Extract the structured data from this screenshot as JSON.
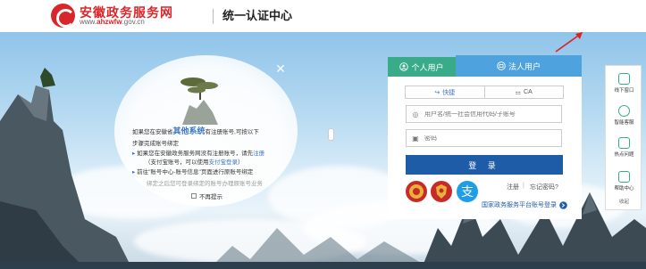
{
  "header": {
    "site_title": "安徽政务服务网",
    "site_url_prefix": "www.",
    "site_url_bold": "ahzwfw",
    "site_url_suffix": ".gov.cn",
    "subtitle": "统一认证中心"
  },
  "notice": {
    "line1_a": "如果您在安徽省",
    "line1_em": "其他系统",
    "line1_b": "有注册账号,可按以下",
    "line2": "步骤完成账号绑定",
    "line3_a": "如果您在安徽政务服务网没有注册账号，请先",
    "line3_link": "注册",
    "line4_a": "（支付宝账号，可以使用",
    "line4_link": "支付宝登录",
    "line4_b": "）",
    "line5": "前往\"账号中心-账号信息\"页面进行原账号绑定",
    "line6": "绑定之后您可登录绑定的账号办理原账号业务",
    "no_remind": "不再提示"
  },
  "login": {
    "tab_personal": "个人用户",
    "tab_legal": "法人用户",
    "mode_quick": "快捷",
    "mode_ca": "CA",
    "username_placeholder": "用户名/统一社会信用代码/子账号",
    "password_placeholder": "密码",
    "login_button": "登 录",
    "register_link": "注册",
    "forgot_link": "忘记密码?",
    "national_link": "国家政务服务平台账号登录"
  },
  "sidebar": {
    "items": [
      {
        "label": "线下窗口"
      },
      {
        "label": "智能客服"
      },
      {
        "label": "热点问题"
      },
      {
        "label": "帮助中心"
      }
    ],
    "close_label": "收起"
  },
  "colors": {
    "brand_red": "#d9262a",
    "personal_green": "#3aab88",
    "legal_blue": "#4ea2dd",
    "login_blue": "#1f5ca7"
  }
}
